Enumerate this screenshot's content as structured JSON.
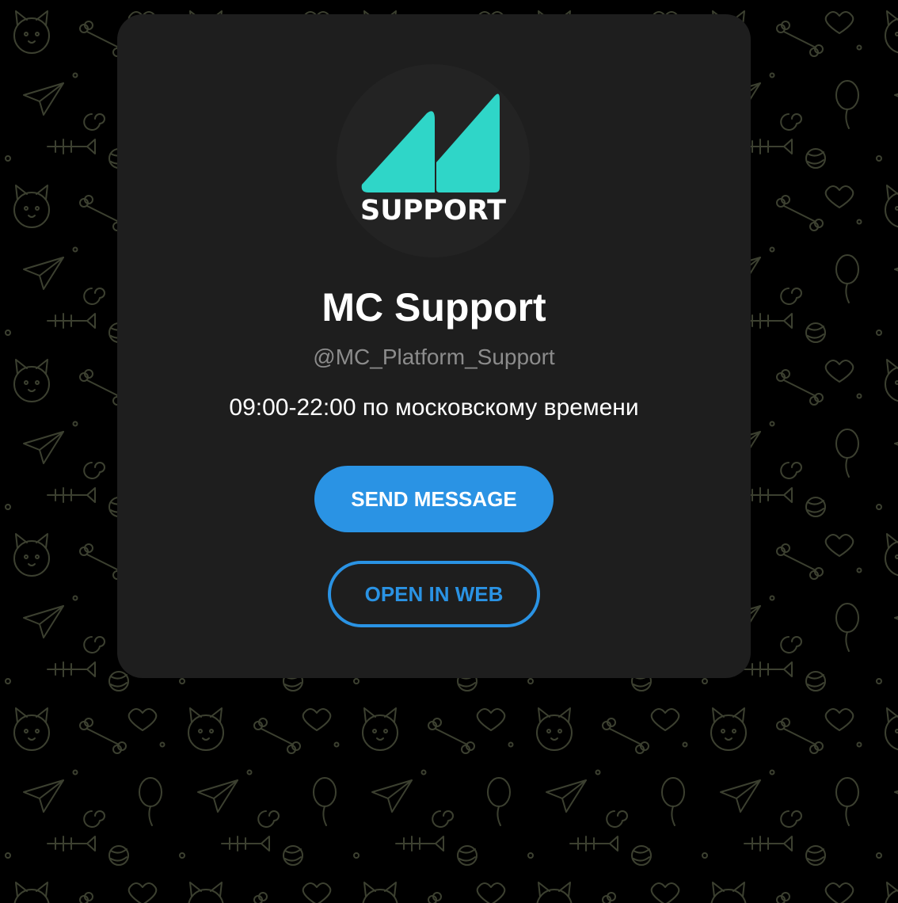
{
  "profile": {
    "avatar_text": "SUPPORT",
    "name": "MC Support",
    "username": "@MC_Platform_Support",
    "description": "09:00-22:00 по московскому времени"
  },
  "actions": {
    "send_message_label": "SEND MESSAGE",
    "open_in_web_label": "OPEN IN WEB"
  },
  "colors": {
    "background": "#000000",
    "card": "#1e1e1e",
    "avatar_circle": "#232323",
    "logo_teal": "#2fd6c8",
    "accent_blue": "#2a93e4",
    "username_gray": "#8c8c8c",
    "doodle_stroke": "#3c4030"
  },
  "icons": {
    "background_pattern": "doodle-pattern",
    "logo": "mc-logo-icon"
  }
}
